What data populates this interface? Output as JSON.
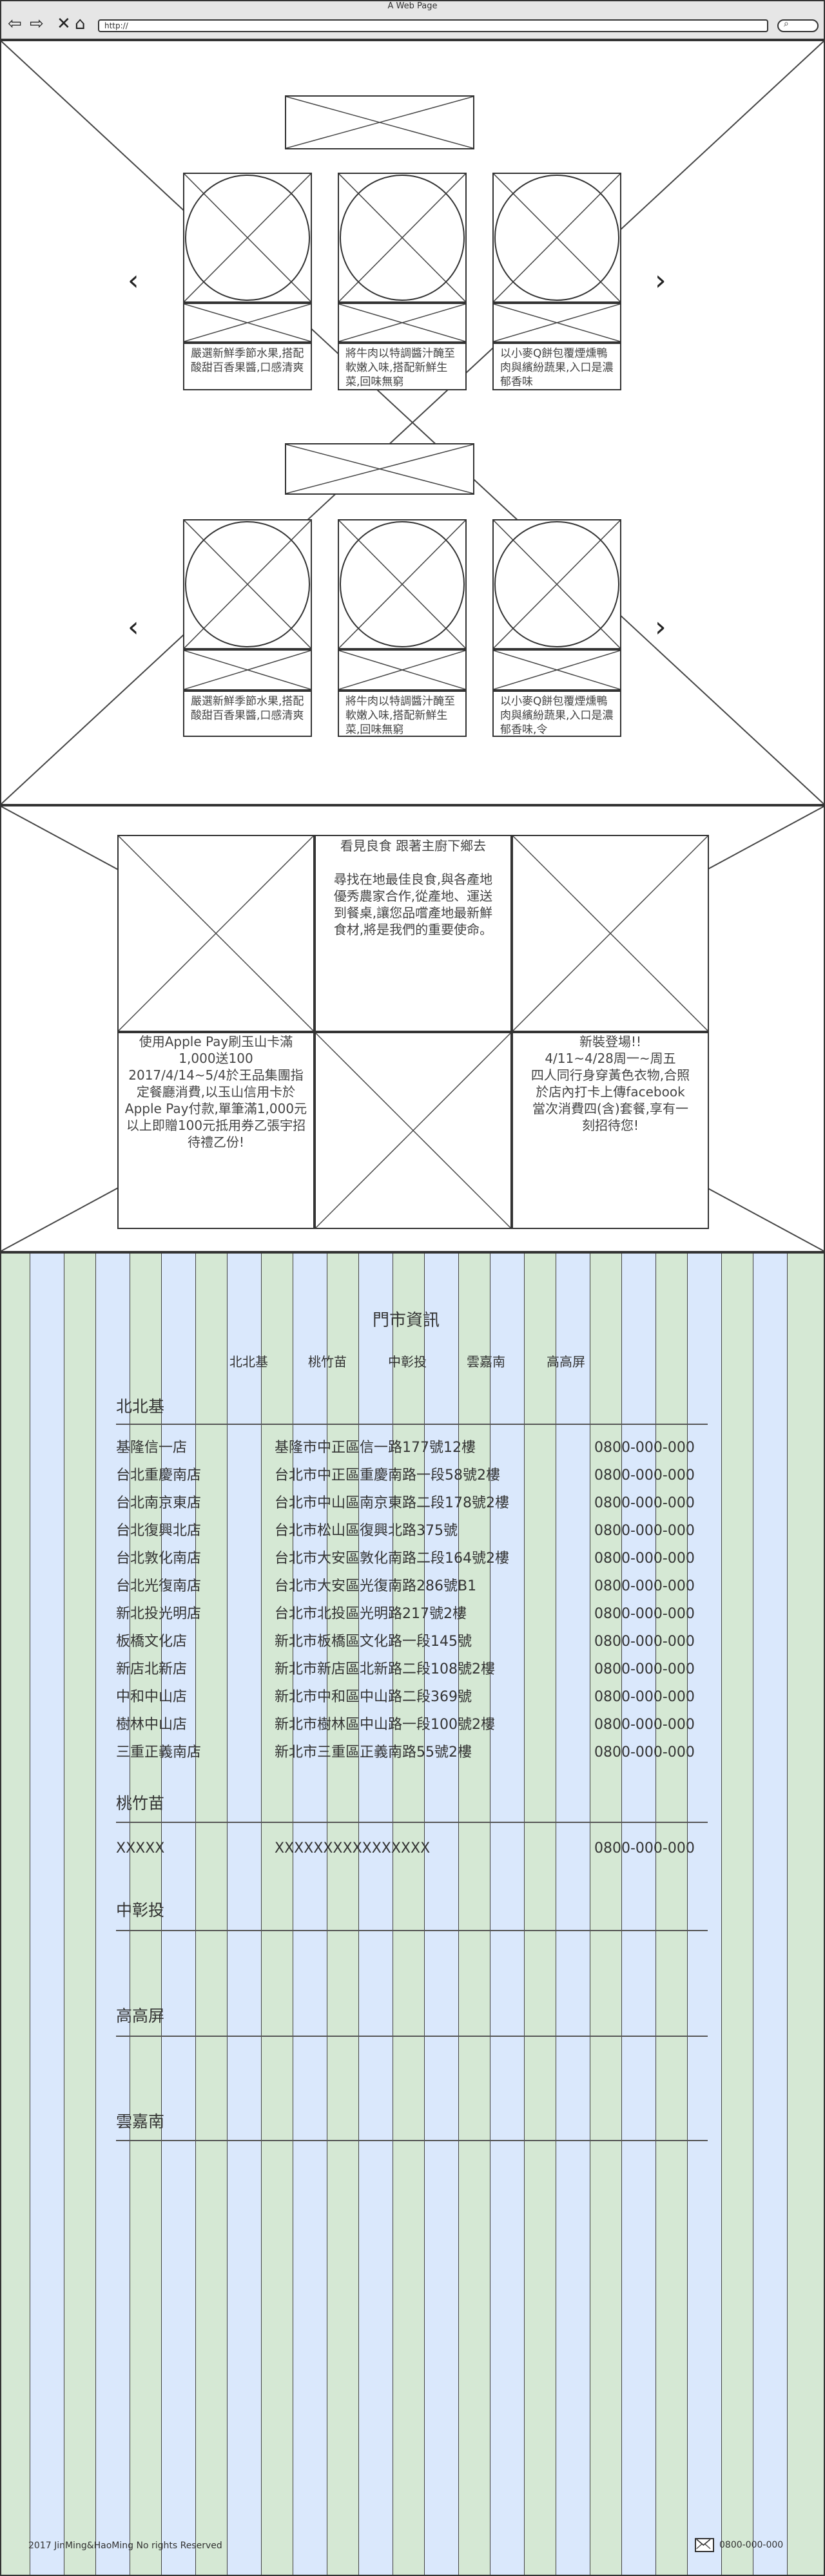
{
  "browser": {
    "title": "A Web Page",
    "url": "http://"
  },
  "carousel_rows": [
    {
      "captions": [
        "嚴選新鮮季節水果,搭配酸甜百香果醬,口感清爽",
        "將牛肉以特調醬汁醃至軟嫩入味,搭配新鮮生菜,回味無窮",
        "以小麥Q餅包覆煙燻鴨肉與繽紛蔬果,入口是濃郁香味"
      ]
    },
    {
      "captions": [
        "嚴選新鮮季節水果,搭配酸甜百香果醬,口感清爽",
        "將牛肉以特調醬汁醃至軟嫩入味,搭配新鮮生菜,回味無窮",
        "以小麥Q餅包覆煙燻鴨肉與繽紛蔬果,入口是濃郁香味,令"
      ]
    }
  ],
  "about": {
    "intro_title": "看見良食 跟著主廚下鄉去",
    "intro_body": "尋找在地最佳良食,與各產地優秀農家合作,從產地、運送到餐桌,讓您品嚐產地最新鮮食材,將是我們的重要使命。",
    "promo_left": "使用Apple Pay刷玉山卡滿1,000送100\n2017/4/14~5/4於王品集團指定餐廳消費,以玉山信用卡於Apple Pay付款,單筆滿1,000元以上即贈100元抵用券乙張宇招待禮乙份!",
    "promo_right_title": "新裝登場!!",
    "promo_right_body": "4/11~4/28周一~周五\n四人同行身穿黃色衣物,合照於店內打卡上傳facebook 當次消費四(含)套餐,享有一刻招待您!"
  },
  "stores": {
    "title": "門市資訊",
    "tabs": [
      "北北基",
      "桃竹苗",
      "中彰投",
      "雲嘉南",
      "高高屏"
    ],
    "regions": [
      {
        "name": "北北基",
        "rows": [
          [
            "基隆信一店",
            "基隆市中正區信一路177號12樓",
            "0800-000-000"
          ],
          [
            "台北重慶南店",
            "台北市中正區重慶南路一段58號2樓",
            "0800-000-000"
          ],
          [
            "台北南京東店",
            "台北市中山區南京東路二段178號2樓",
            "0800-000-000"
          ],
          [
            "台北復興北店",
            "台北市松山區復興北路375號",
            "0800-000-000"
          ],
          [
            "台北敦化南店",
            "台北市大安區敦化南路二段164號2樓",
            "0800-000-000"
          ],
          [
            "台北光復南店",
            "台北市大安區光復南路286號B1",
            "0800-000-000"
          ],
          [
            "新北投光明店",
            "台北市北投區光明路217號2樓",
            "0800-000-000"
          ],
          [
            "板橋文化店",
            "新北市板橋區文化路一段145號",
            "0800-000-000"
          ],
          [
            "新店北新店",
            "新北市新店區北新路二段108號2樓",
            "0800-000-000"
          ],
          [
            "中和中山店",
            "新北市中和區中山路二段369號",
            "0800-000-000"
          ],
          [
            "樹林中山店",
            "新北市樹林區中山路一段100號2樓",
            "0800-000-000"
          ],
          [
            "三重正義南店",
            "新北市三重區正義南路55號2樓",
            "0800-000-000"
          ]
        ]
      },
      {
        "name": "桃竹苗",
        "rows": [
          [
            "XXXXX",
            "XXXXXXXXXXXXXXXX",
            "0800-000-000"
          ]
        ]
      },
      {
        "name": "中彰投",
        "rows": []
      },
      {
        "name": "高高屏",
        "rows": []
      },
      {
        "name": "雲嘉南",
        "rows": []
      }
    ]
  },
  "footer": {
    "copyright": "2017 JinMing&HaoMing No rights Reserved",
    "phone": "0800-000-000",
    "mail_icon": "mail-icon"
  }
}
